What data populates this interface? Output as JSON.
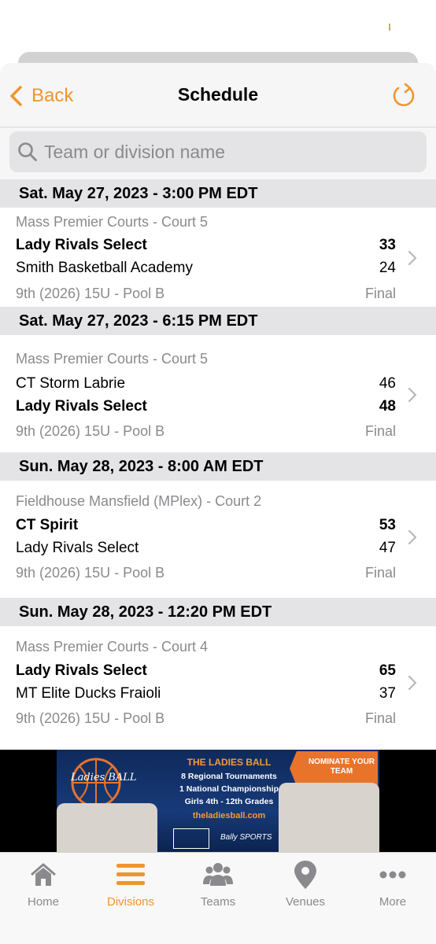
{
  "colors": {
    "accent": "#f0952d",
    "header_bg": "#e4e4e6",
    "muted_text": "#8a8a8e"
  },
  "nav": {
    "back_label": "Back",
    "title": "Schedule",
    "refresh_icon": "refresh-icon"
  },
  "search": {
    "placeholder": "Team or division name",
    "value": ""
  },
  "schedule": [
    {
      "date": "Sat. May 27, 2023 - 3:00 PM EDT",
      "venue": "Mass Premier Courts - Court 5",
      "team1": "Lady Rivals Select",
      "score1": "33",
      "team2": "Smith Basketball Academy",
      "score2": "24",
      "division": "9th (2026) 15U - Pool B",
      "status": "Final"
    },
    {
      "date": "Sat. May 27, 2023 - 6:15 PM EDT",
      "venue": "Mass Premier Courts - Court 5",
      "team1": "CT Storm Labrie",
      "score1": "46",
      "team2": "Lady Rivals Select",
      "score2": "48",
      "division": "9th (2026) 15U - Pool B",
      "status": "Final"
    },
    {
      "date": "Sun. May 28, 2023 - 8:00 AM EDT",
      "venue": "Fieldhouse Mansfield (MPlex) - Court 2",
      "team1": "CT Spirit",
      "score1": "53",
      "team2": "Lady Rivals Select",
      "score2": "47",
      "division": "9th (2026) 15U - Pool B",
      "status": "Final"
    },
    {
      "date": "Sun. May 28, 2023 - 12:20 PM EDT",
      "venue": "Mass Premier Courts - Court 4",
      "team1": "Lady Rivals Select",
      "score1": "65",
      "team2": "MT Elite Ducks Fraioli",
      "score2": "37",
      "division": "9th (2026) 15U - Pool B",
      "status": "Final"
    }
  ],
  "ad": {
    "logo_text": "Ladies BALL",
    "title": "THE LADIES BALL",
    "line1": "8 Regional Tournaments",
    "line2": "1 National Championship",
    "line3": "Girls 4th - 12th Grades",
    "url": "theladiesball.com",
    "nominate": "NOMINATE YOUR TEAM",
    "sponsor": "Bally SPORTS"
  },
  "tabs": [
    {
      "label": "Home",
      "icon": "home-icon"
    },
    {
      "label": "Divisions",
      "icon": "list-icon",
      "active": true
    },
    {
      "label": "Teams",
      "icon": "people-icon"
    },
    {
      "label": "Venues",
      "icon": "location-pin-icon"
    },
    {
      "label": "More",
      "icon": "more-dots-icon"
    }
  ]
}
